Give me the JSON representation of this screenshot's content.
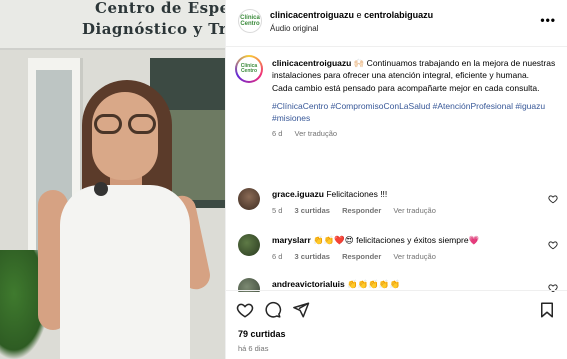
{
  "media": {
    "sign_line1": "Centro de Espec",
    "sign_line2": "Diagnóstico y Trat"
  },
  "header": {
    "user1": "clinicacentroiguazu",
    "joiner": "e",
    "user2": "centrolabiguazu",
    "audio": "Áudio original",
    "avatar_text": "Clínica Centro",
    "more_icon": "more-horizontal-icon"
  },
  "caption": {
    "username": "clinicacentroiguazu",
    "text": "🙌🏻 Continuamos trabajando en la mejora de nuestras instalaciones para ofrecer una atención integral, eficiente y humana.",
    "text2": "Cada cambio está pensado para acompañarte mejor en cada consulta.",
    "hashtags": "#ClínicaCentro #CompromisoConLaSalud #AtenciónProfesional #iguazu #misiones",
    "age": "6 d",
    "translate": "Ver tradução"
  },
  "comments": [
    {
      "username": "grace.iguazu",
      "text": "Felicitaciones !!!",
      "age": "5 d",
      "likes": "3 curtidas",
      "reply": "Responder",
      "translate": "Ver tradução"
    },
    {
      "username": "maryslarr",
      "text": "👏👏❤️😍 felicitaciones y éxitos siempre💗",
      "age": "6 d",
      "likes": "3 curtidas",
      "reply": "Responder",
      "translate": "Ver tradução"
    },
    {
      "username": "andreavictorialuis",
      "text": "👏👏👏👏👏"
    }
  ],
  "footer": {
    "likes": "79 curtidas",
    "time": "há 6 dias"
  },
  "colors": {
    "link": "#385898",
    "muted": "#737373"
  }
}
